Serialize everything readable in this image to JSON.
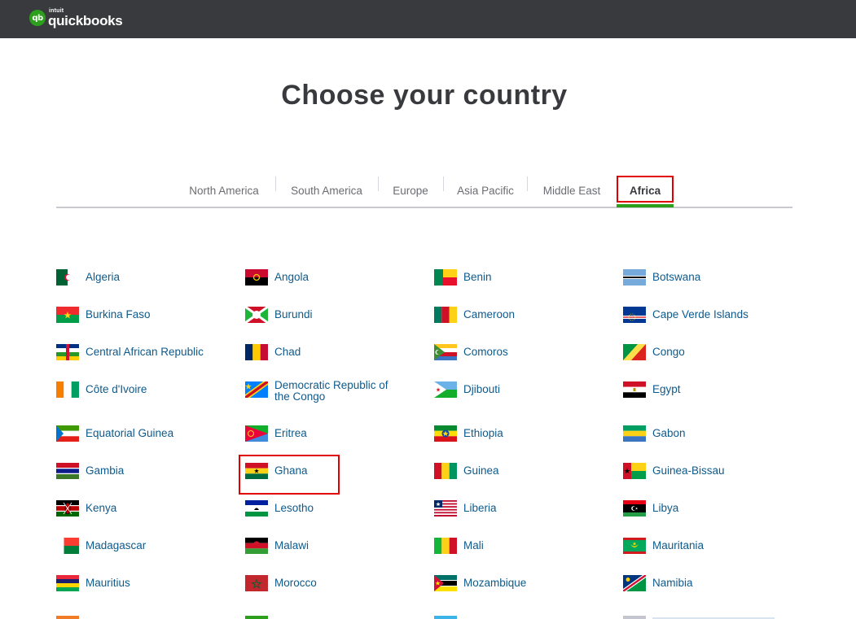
{
  "header": {
    "logo_intuit": "intuit",
    "logo_name": "quickbooks",
    "logo_mark": "qb"
  },
  "page_title": "Choose your country",
  "tabs": [
    {
      "label": "North America",
      "active": false
    },
    {
      "label": "South America",
      "active": false
    },
    {
      "label": "Europe",
      "active": false
    },
    {
      "label": "Asia Pacific",
      "active": false
    },
    {
      "label": "Middle East",
      "active": false
    },
    {
      "label": "Africa",
      "active": true
    }
  ],
  "colors": {
    "accent": "#2ca01c",
    "link": "#0d5a8c",
    "highlight": "#e00000",
    "header_bg": "#393a3d"
  },
  "countries": [
    {
      "name": "Algeria",
      "flag": "algeria-flag-icon"
    },
    {
      "name": "Angola",
      "flag": "angola-flag-icon"
    },
    {
      "name": "Benin",
      "flag": "benin-flag-icon"
    },
    {
      "name": "Botswana",
      "flag": "botswana-flag-icon"
    },
    {
      "name": "Burkina Faso",
      "flag": "burkina-faso-flag-icon"
    },
    {
      "name": "Burundi",
      "flag": "burundi-flag-icon"
    },
    {
      "name": "Cameroon",
      "flag": "cameroon-flag-icon"
    },
    {
      "name": "Cape Verde Islands",
      "flag": "cape-verde-flag-icon"
    },
    {
      "name": "Central African Republic",
      "flag": "central-african-republic-flag-icon"
    },
    {
      "name": "Chad",
      "flag": "chad-flag-icon"
    },
    {
      "name": "Comoros",
      "flag": "comoros-flag-icon"
    },
    {
      "name": "Congo",
      "flag": "congo-flag-icon"
    },
    {
      "name": "Côte d'Ivoire",
      "flag": "cote-divoire-flag-icon"
    },
    {
      "name": "Democratic Republic of the Congo",
      "flag": "dr-congo-flag-icon"
    },
    {
      "name": "Djibouti",
      "flag": "djibouti-flag-icon"
    },
    {
      "name": "Egypt",
      "flag": "egypt-flag-icon"
    },
    {
      "name": "Equatorial Guinea",
      "flag": "equatorial-guinea-flag-icon"
    },
    {
      "name": "Eritrea",
      "flag": "eritrea-flag-icon"
    },
    {
      "name": "Ethiopia",
      "flag": "ethiopia-flag-icon"
    },
    {
      "name": "Gabon",
      "flag": "gabon-flag-icon"
    },
    {
      "name": "Gambia",
      "flag": "gambia-flag-icon"
    },
    {
      "name": "Ghana",
      "flag": "ghana-flag-icon",
      "highlighted": true
    },
    {
      "name": "Guinea",
      "flag": "guinea-flag-icon"
    },
    {
      "name": "Guinea-Bissau",
      "flag": "guinea-bissau-flag-icon"
    },
    {
      "name": "Kenya",
      "flag": "kenya-flag-icon"
    },
    {
      "name": "Lesotho",
      "flag": "lesotho-flag-icon"
    },
    {
      "name": "Liberia",
      "flag": "liberia-flag-icon"
    },
    {
      "name": "Libya",
      "flag": "libya-flag-icon"
    },
    {
      "name": "Madagascar",
      "flag": "madagascar-flag-icon"
    },
    {
      "name": "Malawi",
      "flag": "malawi-flag-icon"
    },
    {
      "name": "Mali",
      "flag": "mali-flag-icon"
    },
    {
      "name": "Mauritania",
      "flag": "mauritania-flag-icon"
    },
    {
      "name": "Mauritius",
      "flag": "mauritius-flag-icon"
    },
    {
      "name": "Morocco",
      "flag": "morocco-flag-icon"
    },
    {
      "name": "Mozambique",
      "flag": "mozambique-flag-icon"
    },
    {
      "name": "Namibia",
      "flag": "namibia-flag-icon"
    }
  ]
}
